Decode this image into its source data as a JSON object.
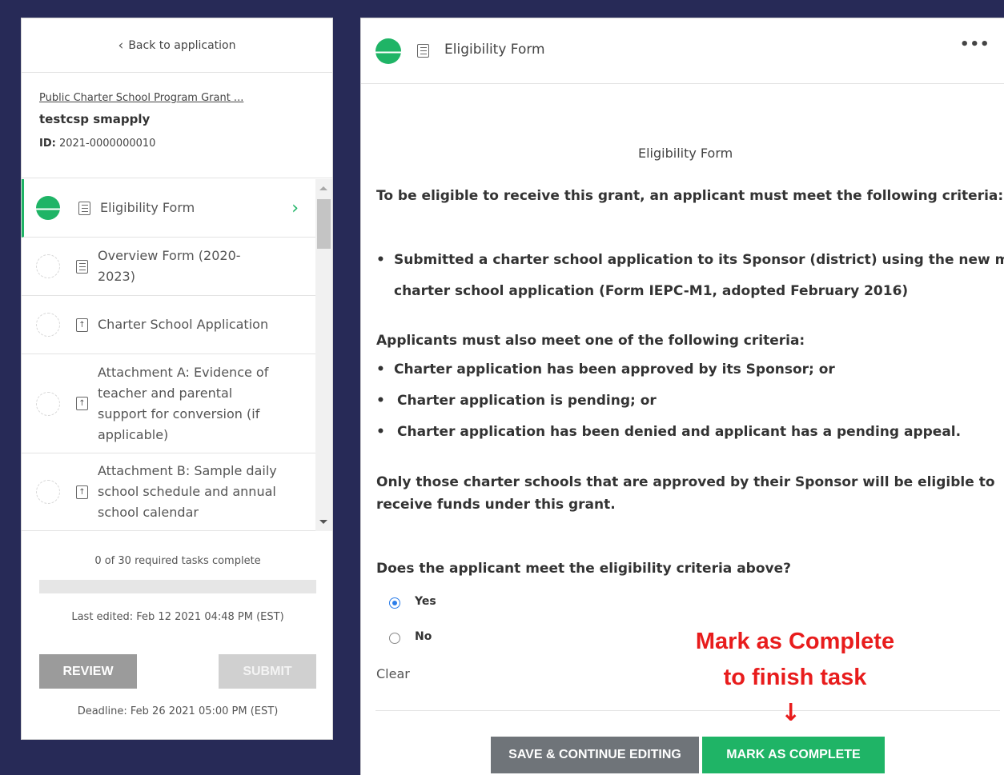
{
  "sidebar": {
    "back_label": "Back to application",
    "program_name": "Public Charter School Program Grant ...",
    "applicant_name": "testcsp smapply",
    "id_label": "ID:",
    "id_value": "2021-0000000010",
    "tasks": [
      {
        "label": "Eligibility Form",
        "icon": "document-icon",
        "active": true
      },
      {
        "label": "Overview Form (2020-2023)",
        "icon": "document-icon",
        "active": false
      },
      {
        "label": "Charter School Application",
        "icon": "upload-icon",
        "active": false
      },
      {
        "label": "Attachment A: Evidence of teacher and parental support for conversion (if applicable)",
        "icon": "upload-icon",
        "active": false
      },
      {
        "label": "Attachment B: Sample daily school schedule and annual school calendar",
        "icon": "upload-icon",
        "active": false
      }
    ],
    "progress_text": "0 of 30 required tasks complete",
    "progress_fraction": 0,
    "last_edited": "Last edited: Feb 12 2021 04:48 PM (EST)",
    "review_label": "REVIEW",
    "submit_label": "SUBMIT",
    "deadline": "Deadline: Feb 26 2021 05:00 PM (EST)"
  },
  "main": {
    "header_title": "Eligibility Form",
    "more_label": "•••",
    "form_title": "Eligibility Form",
    "intro": "To be eligible to receive this grant, an applicant must meet the following criteria:",
    "criteria_line1": "Submitted a charter school application to its Sponsor (district) using the new model",
    "criteria_line2": "charter school application (Form IEPC-M1, adopted February 2016)",
    "also_meet": "Applicants must also meet one of the following criteria:",
    "options": [
      "Charter application has been approved by its Sponsor; or",
      "Charter application is pending; or",
      "Charter application has been denied and applicant has a pending appeal."
    ],
    "only_line1": "Only those charter schools that are approved by their Sponsor will be eligible to",
    "only_line2": "receive funds under this grant.",
    "question": "Does the applicant meet the eligibility criteria above?",
    "answers": [
      {
        "label": "Yes",
        "selected": true
      },
      {
        "label": "No",
        "selected": false
      }
    ],
    "clear_label": "Clear",
    "save_label": "SAVE & CONTINUE EDITING",
    "complete_label": "MARK AS COMPLETE"
  },
  "annotation": {
    "line1": "Mark as Complete",
    "line2": "to finish task",
    "arrow": "↓",
    "color": "#e81c1c"
  },
  "colors": {
    "background": "#272a57",
    "accent_green": "#1fb466",
    "radio_blue": "#2b7de9"
  }
}
